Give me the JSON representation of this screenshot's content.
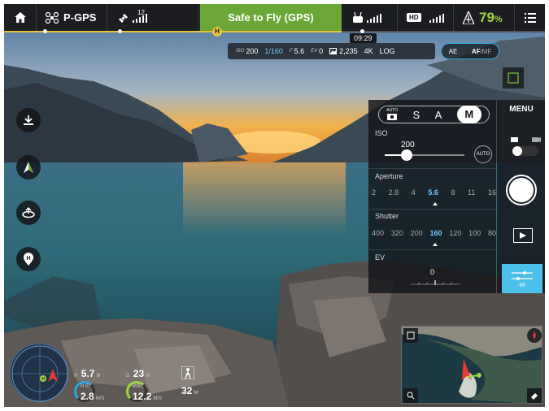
{
  "topbar": {
    "flight_mode": "P-GPS",
    "satellite_count": "12",
    "flight_status": "Safe to Fly (GPS)",
    "hd_label": "HD",
    "battery_percent": "79",
    "battery_unit": "%",
    "flight_time": "09:29"
  },
  "camera": {
    "iso_key": "ISO",
    "iso_value": "200",
    "shutter_value": "1/160",
    "aperture_key": "F",
    "aperture_value": "5.6",
    "ev_key": "EV",
    "ev_value": "0",
    "storage_value": "2,235",
    "resolution": "4K",
    "color_profile": "LOG",
    "ae_label": "AE",
    "af_label": "AF",
    "mf_label": "/MF"
  },
  "panel": {
    "modes": {
      "auto_label": "AUTO",
      "s_label": "S",
      "a_label": "A",
      "m_label": "M"
    },
    "iso_label": "ISO",
    "iso_value": "200",
    "iso_slider_fraction": 0.28,
    "iso_auto_label": "AUTO",
    "aperture_label": "Aperture",
    "aperture_values": [
      "2",
      "2.8",
      "4",
      "5.6",
      "8",
      "11",
      "16"
    ],
    "aperture_selected": "5.6",
    "shutter_label": "Shutter",
    "shutter_values": [
      "400",
      "320",
      "200",
      "160",
      "120",
      "100",
      "80"
    ],
    "shutter_selected": "160",
    "ev_label": "EV",
    "ev_value": "0"
  },
  "right": {
    "menu_label": "MENU"
  },
  "telemetry": {
    "h_key": "H",
    "h_value": "5.7",
    "h_unit": "M",
    "d_key": "D",
    "d_value": "23",
    "d_unit": "M",
    "hs_key": "H.S",
    "hs_value": "2.8",
    "hs_unit": "M/S",
    "vs_key": "V.S",
    "vs_value": "12.2",
    "vs_unit": "M/S",
    "alt_value": "32",
    "alt_unit": "M"
  },
  "colors": {
    "accent": "#4cc0ea",
    "safe": "#6aa737",
    "battery": "#9ed443",
    "progress": "#e8c23a"
  },
  "icons": [
    "home-icon",
    "drone-icon",
    "satellite-icon",
    "remote-controller-icon",
    "battery-icon",
    "menu-icon",
    "takeoff-icon",
    "navigation-icon",
    "orbit-icon",
    "landing-icon",
    "shutter-icon",
    "playback-icon",
    "exposure-settings-icon",
    "zoom-icon",
    "eraser-icon",
    "compass-icon"
  ]
}
